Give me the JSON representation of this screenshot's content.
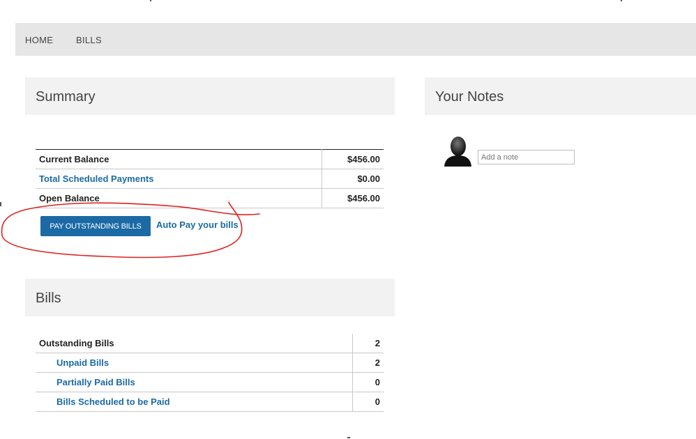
{
  "nav": {
    "items": [
      {
        "label": "HOME"
      },
      {
        "label": "BILLS"
      }
    ]
  },
  "summary": {
    "title": "Summary",
    "rows": [
      {
        "label": "Current Balance",
        "value": "$456.00"
      },
      {
        "label": "Total Scheduled Payments",
        "value": "$0.00"
      },
      {
        "label": "Open Balance",
        "value": "$456.00"
      }
    ],
    "pay_button_label": "PAY OUTSTANDING BILLS",
    "autopay_link_label": "Auto Pay your bills"
  },
  "notes": {
    "title": "Your Notes",
    "placeholder": "Add a note"
  },
  "bills": {
    "title": "Bills",
    "rows": [
      {
        "label": "Outstanding Bills",
        "value": "2"
      },
      {
        "label": "Unpaid Bills",
        "value": "2"
      },
      {
        "label": "Partially Paid Bills",
        "value": "0"
      },
      {
        "label": "Bills Scheduled to be Paid",
        "value": "0"
      }
    ]
  },
  "colors": {
    "accent": "#1b6aa5",
    "nav_bg": "#e6e6e6",
    "panel_bg": "#f2f2f2",
    "annotation": "#e02020"
  },
  "icons": {
    "avatar": "user-silhouette-icon"
  }
}
